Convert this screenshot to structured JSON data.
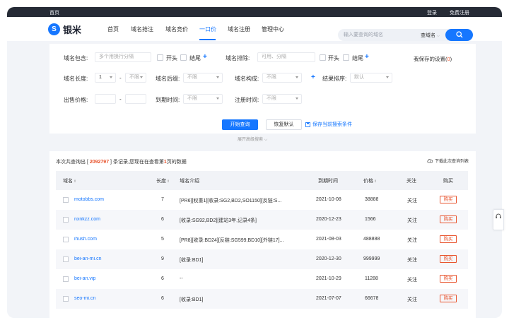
{
  "topbar": {
    "home": "首页",
    "login": "登录",
    "register": "免费注册"
  },
  "logo": {
    "mark": "S",
    "text": "银米"
  },
  "nav": {
    "items": [
      "首页",
      "域名抢注",
      "域名竞价",
      "一口价",
      "域名注册",
      "管理中心"
    ],
    "active_index": 3
  },
  "search": {
    "placeholder": "输入要查询的域名",
    "type": "查域名"
  },
  "filters": {
    "contains_label": "域名包含:",
    "contains_placeholder": "多个用换行分隔",
    "start_label": "开头",
    "end_label": "结尾",
    "exclude_label": "域名排除:",
    "exclude_placeholder": "可用、分隔",
    "saved_settings_prefix": "我保存的设置(",
    "saved_settings_count": "0",
    "saved_settings_suffix": ")",
    "length_label": "域名长度:",
    "length_min": "1",
    "length_sep": "-",
    "length_max": "不限",
    "suffix_label": "域名后缀:",
    "suffix_value": "不限",
    "composition_label": "域名构成:",
    "composition_value": "不限",
    "sort_label": "结果排序:",
    "sort_value": "默认",
    "price_label": "出售价格:",
    "price_sep": "-",
    "expiry_label": "到期时间:",
    "expiry_value": "不限",
    "regtime_label": "注册时间:",
    "regtime_value": "不限"
  },
  "actions": {
    "search": "开始查询",
    "reset": "恢复默认",
    "save": "保存当前搜索条件"
  },
  "expand_label": "展开高级搜索",
  "results": {
    "summary_prefix": "本次共查询出 [ ",
    "total": "2092797",
    "summary_mid": " ] 条记录,您现在在查看第",
    "page": "1",
    "summary_suffix": "页的数据",
    "download": "下载此次查询列表",
    "columns": {
      "name": "域名",
      "length": "长度",
      "intro": "域名介绍",
      "expiry": "到期时间",
      "price": "价格",
      "follow": "关注",
      "buy": "购买"
    },
    "rows": [
      {
        "name": "motobbs.com",
        "length": "7",
        "intro": "[PR6][权重1][收录:SG2,BD2,SO1150][反链:S...",
        "expiry": "2021-10-08",
        "price": "38888",
        "follow": "关注",
        "buy": "购买"
      },
      {
        "name": "nxnkzz.com",
        "length": "6",
        "intro": "[收录:SG92,BD2][建站3年,记录4条]",
        "expiry": "2020-12-23",
        "price": "1566",
        "follow": "关注",
        "buy": "购买"
      },
      {
        "name": "ihush.com",
        "length": "5",
        "intro": "[PR8][收录:BD24][反链:SG599,BD10][外链17]...",
        "expiry": "2021-08-03",
        "price": "488888",
        "follow": "关注",
        "buy": "购买"
      },
      {
        "name": "bei-an-mi.cn",
        "length": "9",
        "intro": "[收录:BD1]",
        "expiry": "2020-12-30",
        "price": "999999",
        "follow": "关注",
        "buy": "购买"
      },
      {
        "name": "bei-an.vip",
        "length": "6",
        "intro": "--",
        "expiry": "2021-10-29",
        "price": "11288",
        "follow": "关注",
        "buy": "购买"
      },
      {
        "name": "seo-mi.cn",
        "length": "6",
        "intro": "[收录:BD1]",
        "expiry": "2021-07-07",
        "price": "66678",
        "follow": "关注",
        "buy": "购买"
      }
    ]
  },
  "colors": {
    "primary": "#1677ff",
    "accent": "#e8542e",
    "topbar": "#262b36"
  }
}
